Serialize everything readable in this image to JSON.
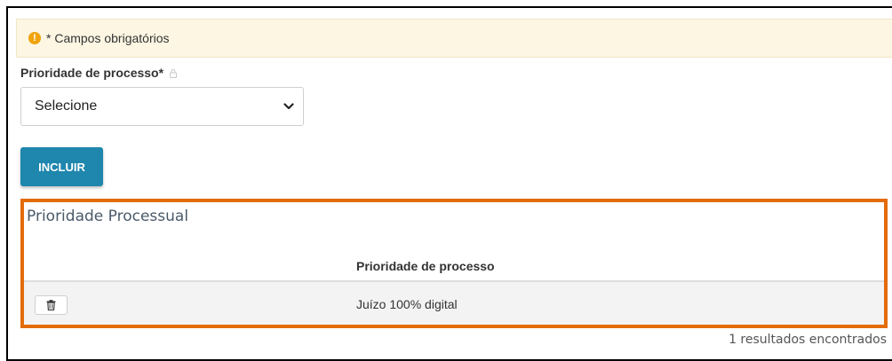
{
  "alert": {
    "icon": "exclamation-circle-icon",
    "text": "* Campos obrigatórios"
  },
  "form": {
    "priority_label": "Prioridade de processo*",
    "priority_select_value": "Selecione",
    "include_button_label": "INCLUIR"
  },
  "panel": {
    "title": "Prioridade Processual",
    "column_header": "Prioridade de processo",
    "rows": [
      {
        "action_icon": "trash-icon",
        "value": "Juízo 100% digital"
      }
    ],
    "results_text": "1 resultados encontrados"
  },
  "colors": {
    "alert_background": "#fcf6e3",
    "warning_icon": "#f0a30a",
    "primary_button": "#1f86ad",
    "highlight_border": "#e36c0a"
  }
}
